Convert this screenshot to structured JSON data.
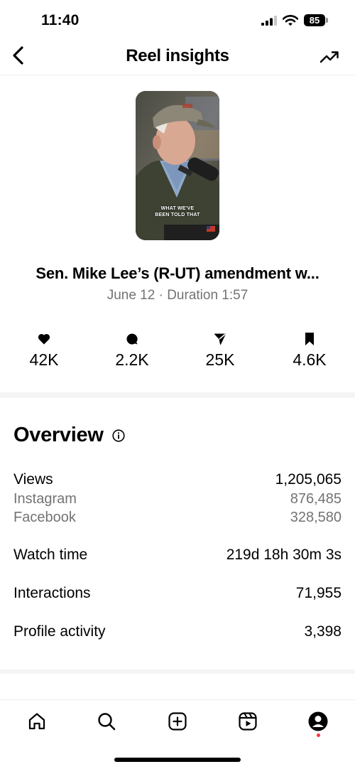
{
  "status_bar": {
    "time": "11:40",
    "battery": "85"
  },
  "header": {
    "title": "Reel insights",
    "back_icon": "chevron-left-icon",
    "trend_icon": "trending-up-icon"
  },
  "reel": {
    "thumbnail_caption": "WHAT WE'VE\nBEEN TOLD THAT",
    "title": "Sen. Mike Lee’s (R-UT) amendment w...",
    "meta": "June 12 · Duration 1:57"
  },
  "stats": [
    {
      "icon": "heart-icon",
      "value": "42K"
    },
    {
      "icon": "comment-icon",
      "value": "2.2K"
    },
    {
      "icon": "share-icon",
      "value": "25K"
    },
    {
      "icon": "bookmark-icon",
      "value": "4.6K"
    }
  ],
  "overview": {
    "title": "Overview",
    "rows": [
      {
        "label": "Views",
        "value": "1,205,065"
      },
      {
        "label": "Instagram",
        "value": "876,485"
      },
      {
        "label": "Facebook",
        "value": "328,580"
      },
      {
        "label": "Watch time",
        "value": "219d 18h 30m 3s"
      },
      {
        "label": "Interactions",
        "value": "71,955"
      },
      {
        "label": "Profile activity",
        "value": "3,398"
      }
    ]
  },
  "tab_bar": [
    "home-icon",
    "search-icon",
    "create-icon",
    "reels-icon",
    "profile-icon"
  ],
  "colors": {
    "secondary_text": "#737373",
    "notification": "#ff3040"
  }
}
